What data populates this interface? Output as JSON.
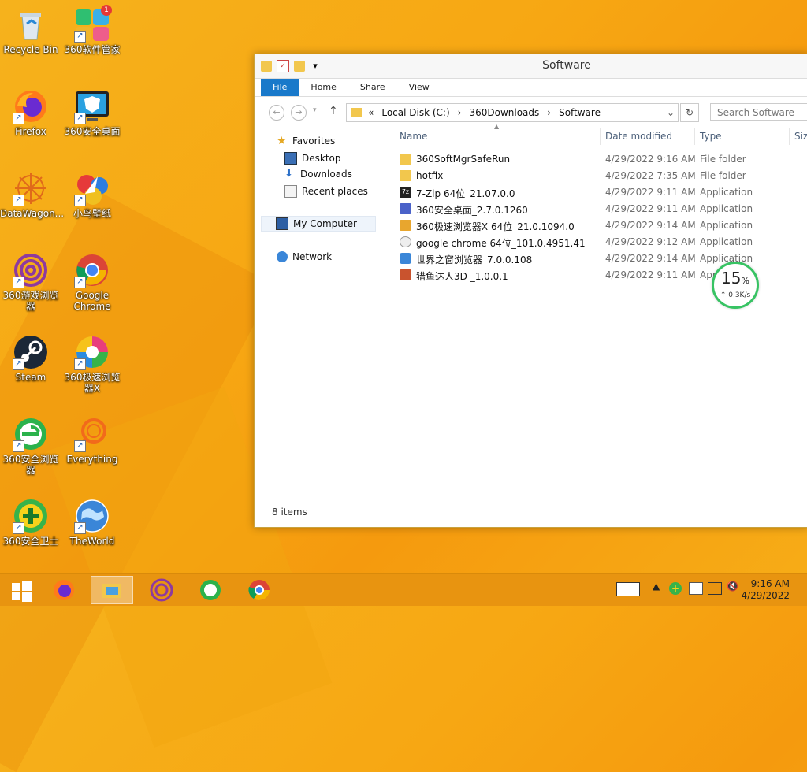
{
  "desktop": {
    "icons": [
      {
        "label": "Recycle Bin"
      },
      {
        "label": "360软件管家",
        "badge": "1"
      },
      {
        "label": "Firefox"
      },
      {
        "label": "360安全桌面"
      },
      {
        "label": "DataWagon..."
      },
      {
        "label": "小鸟壁纸"
      },
      {
        "label": "360游戏浏览器"
      },
      {
        "label": "Google Chrome"
      },
      {
        "label": "Steam"
      },
      {
        "label": "360极速浏览器X"
      },
      {
        "label": "360安全浏览器"
      },
      {
        "label": "Everything"
      },
      {
        "label": "360安全卫士"
      },
      {
        "label": "TheWorld"
      }
    ]
  },
  "explorer": {
    "title": "Software",
    "ribbon_tabs": [
      "File",
      "Home",
      "Share",
      "View"
    ],
    "breadcrumb": [
      "«",
      "Local Disk (C:)",
      "›",
      "360Downloads",
      "›",
      "Software"
    ],
    "search_placeholder": "Search Software",
    "nav": {
      "favorites": "Favorites",
      "desktop": "Desktop",
      "downloads": "Downloads",
      "recent": "Recent places",
      "computer": "My Computer",
      "network": "Network"
    },
    "columns": [
      "Name",
      "Date modified",
      "Type",
      "Size"
    ],
    "files": [
      {
        "name": "360SoftMgrSafeRun",
        "date": "4/29/2022 9:16 AM",
        "type": "File folder",
        "icon": "folder-icon"
      },
      {
        "name": "hotfix",
        "date": "4/29/2022 7:35 AM",
        "type": "File folder",
        "icon": "folder-icon"
      },
      {
        "name": "7-Zip 64位_21.07.0.0",
        "date": "4/29/2022 9:11 AM",
        "type": "Application",
        "icon": "7zip-icon"
      },
      {
        "name": "360安全桌面_2.7.0.1260",
        "date": "4/29/2022 9:11 AM",
        "type": "Application",
        "icon": "360desk-icon"
      },
      {
        "name": "360极速浏览器X 64位_21.0.1094.0",
        "date": "4/29/2022 9:14 AM",
        "type": "Application",
        "icon": "360jisu-icon"
      },
      {
        "name": "google chrome 64位_101.0.4951.41",
        "date": "4/29/2022 9:12 AM",
        "type": "Application",
        "icon": "chrome-installer-icon"
      },
      {
        "name": "世界之窗浏览器_7.0.0.108",
        "date": "4/29/2022 9:14 AM",
        "type": "Application",
        "icon": "theworld-icon"
      },
      {
        "name": "猎鱼达人3D _1.0.0.1",
        "date": "4/29/2022 9:11 AM",
        "type": "App",
        "icon": "fishing-icon"
      }
    ],
    "status": "8 items"
  },
  "speed_widget": {
    "percent": "15",
    "unit": "%",
    "rate": "↑ 0.3K/s"
  },
  "taskbar": {
    "time": "9:16 AM",
    "date": "4/29/2022"
  },
  "colors": {
    "accent": "#1979ca",
    "desktop": "#f6a716",
    "taskbar": "#e89410"
  }
}
